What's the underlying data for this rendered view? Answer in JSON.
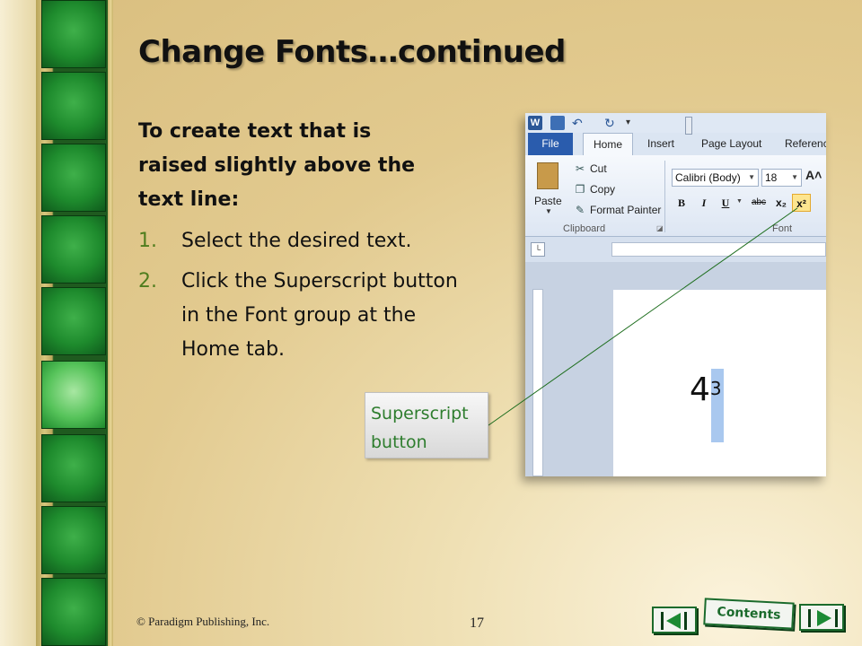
{
  "slide": {
    "title": "Change Fonts…continued",
    "intro": "To create text that is raised slightly above the text line:",
    "steps": [
      {
        "num": "1.",
        "text": "Select the desired text."
      },
      {
        "num": "2.",
        "text": "Click the Superscript button in the Font group at the Home tab."
      }
    ],
    "callout": {
      "line1": "Superscript",
      "line2": "button"
    },
    "copyright": "© Paradigm Publishing, Inc.",
    "page_number": "17",
    "nav": {
      "contents_label": "Contents"
    }
  },
  "screenshot": {
    "app_logo": "W",
    "tabs": {
      "file": "File",
      "home": "Home",
      "insert": "Insert",
      "page_layout": "Page Layout",
      "references": "Referenc"
    },
    "clipboard": {
      "paste": "Paste",
      "cut": "Cut",
      "copy": "Copy",
      "format_painter": "Format Painter",
      "group": "Clipboard"
    },
    "font": {
      "family": "Calibri (Body)",
      "size": "18",
      "group": "Font",
      "bold": "B",
      "italic": "I",
      "underline": "U",
      "strikethrough": "abc",
      "subscript": "x₂",
      "superscript": "x²"
    },
    "document": {
      "base": "4",
      "superscript": "3"
    }
  },
  "colors": {
    "accent_green": "#4f7d1e",
    "callout_text": "#2e7d2e",
    "nav_green": "#1b6b2c",
    "superscript_highlight": "#fde58f"
  }
}
